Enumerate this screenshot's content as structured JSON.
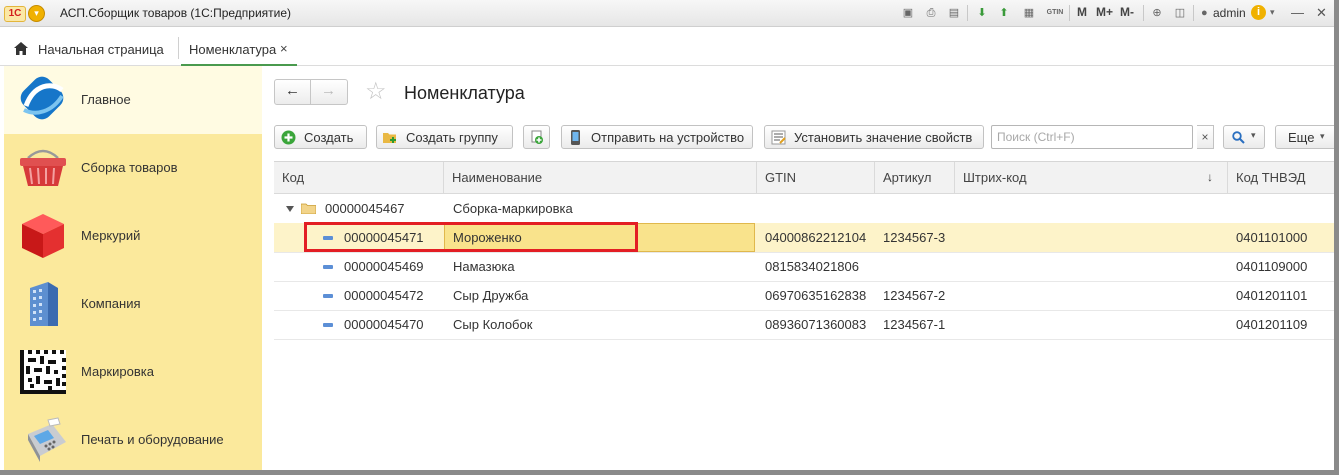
{
  "app": {
    "logo": "1С",
    "title": "АСП.Сборщик товаров  (1С:Предприятие)",
    "toolbar_labels": {
      "m": "M",
      "mplus": "M+",
      "mminus": "M-"
    },
    "calendar_label": "31",
    "gtin_icon_label": "GTIN",
    "user": "admin",
    "info": "i"
  },
  "tabs": {
    "home_label": "Начальная страница",
    "active_label": "Номенклатура",
    "close_glyph": "×"
  },
  "sidebar": {
    "items": [
      {
        "label": "Главное",
        "icon": "main-logo-icon",
        "active": true
      },
      {
        "label": "Сборка товаров",
        "icon": "basket-icon",
        "active": false
      },
      {
        "label": "Меркурий",
        "icon": "cube-icon",
        "active": false
      },
      {
        "label": "Компания",
        "icon": "building-icon",
        "active": false
      },
      {
        "label": "Маркировка",
        "icon": "datamatrix-icon",
        "active": false
      },
      {
        "label": "Печать и оборудование",
        "icon": "terminal-icon",
        "active": false
      }
    ]
  },
  "page": {
    "title": "Номенклатура",
    "nav_back": "←",
    "nav_forward": "→",
    "star": "☆"
  },
  "commands": {
    "create": "Создать",
    "create_group": "Создать группу",
    "send_to_device": "Отправить на устройство",
    "set_properties": "Установить значение свойств",
    "search_placeholder": "Поиск (Ctrl+F)",
    "search_clear": "×",
    "more": "Еще",
    "dropdown": "▾"
  },
  "table": {
    "columns": [
      "Код",
      "Наименование",
      "GTIN",
      "Артикул",
      "Штрих-код",
      "Код ТНВЭД"
    ],
    "sort_arrow": "↓",
    "rows": [
      {
        "type": "group",
        "code": "00000045467",
        "name": "Сборка-маркировка",
        "gtin": "",
        "article": "",
        "barcode": "",
        "tnved": ""
      },
      {
        "type": "item",
        "code": "00000045471",
        "name": "Мороженко",
        "gtin": "04000862212104",
        "article": "1234567-3",
        "barcode": "",
        "tnved": "0401101000",
        "selected": true
      },
      {
        "type": "item",
        "code": "00000045469",
        "name": "Намазюка",
        "gtin": "0815834021806",
        "article": "",
        "barcode": "",
        "tnved": "0401109000"
      },
      {
        "type": "item",
        "code": "00000045472",
        "name": "Сыр Дружба",
        "gtin": "06970635162838",
        "article": "1234567-2",
        "barcode": "",
        "tnved": "0401201101"
      },
      {
        "type": "item",
        "code": "00000045470",
        "name": "Сыр Колобок",
        "gtin": "08936071360083",
        "article": "1234567-1",
        "barcode": "",
        "tnved": "0401201109"
      }
    ]
  },
  "colors": {
    "sidebar_bg": "#fbe99c",
    "selection_bg": "#fdf3c9",
    "highlight_border": "#e31e24",
    "accent_green": "#4a9a4e"
  }
}
